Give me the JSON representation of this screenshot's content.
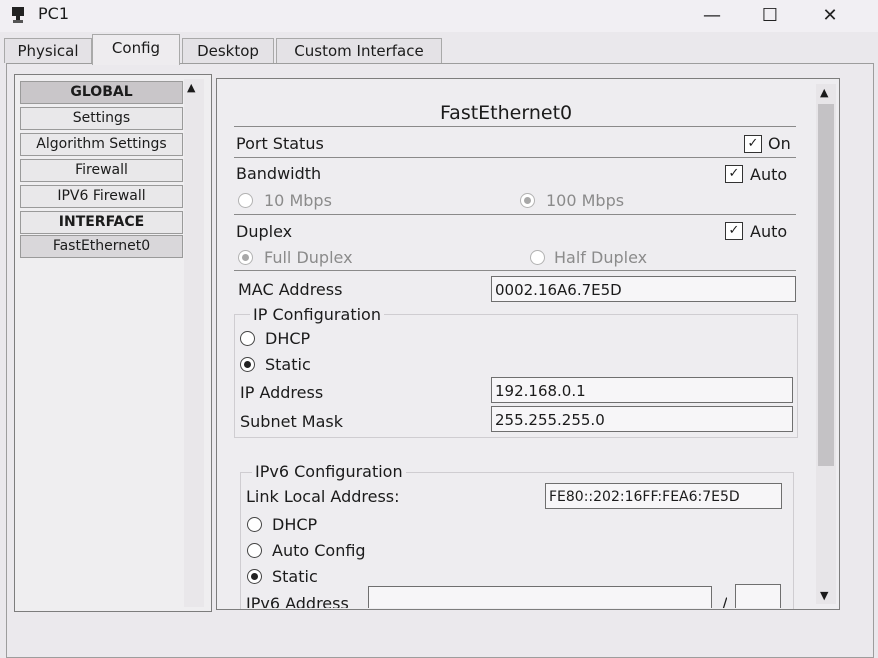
{
  "window": {
    "title": "PC1",
    "minimize": "—",
    "maximize": "☐",
    "close": "✕"
  },
  "tabs": [
    "Physical",
    "Config",
    "Desktop",
    "Custom Interface"
  ],
  "sidebar": {
    "items": [
      "GLOBAL",
      "Settings",
      "Algorithm Settings",
      "Firewall",
      "IPV6 Firewall",
      "INTERFACE",
      "FastEthernet0"
    ]
  },
  "interface": {
    "title": "FastEthernet0",
    "port_status": {
      "label": "Port Status",
      "check_label": "On",
      "checked": true
    },
    "bandwidth": {
      "label": "Bandwidth",
      "check_label": "Auto",
      "checked": true,
      "option1": "10 Mbps",
      "option2": "100 Mbps"
    },
    "duplex": {
      "label": "Duplex",
      "check_label": "Auto",
      "checked": true,
      "option1": "Full Duplex",
      "option2": "Half Duplex"
    },
    "mac": {
      "label": "MAC Address",
      "value": "0002.16A6.7E5D"
    },
    "ip_config": {
      "title": "IP Configuration",
      "dhcp": "DHCP",
      "static": "Static",
      "ip_label": "IP Address",
      "ip_value": "192.168.0.1",
      "mask_label": "Subnet Mask",
      "mask_value": "255.255.255.0"
    },
    "ipv6_config": {
      "title": "IPv6 Configuration",
      "link_local_label": "Link Local Address:",
      "link_local_value": "FE80::202:16FF:FEA6:7E5D",
      "dhcp": "DHCP",
      "auto": "Auto Config",
      "static": "Static",
      "addr_label": "IPv6 Address",
      "slash": "/"
    }
  }
}
